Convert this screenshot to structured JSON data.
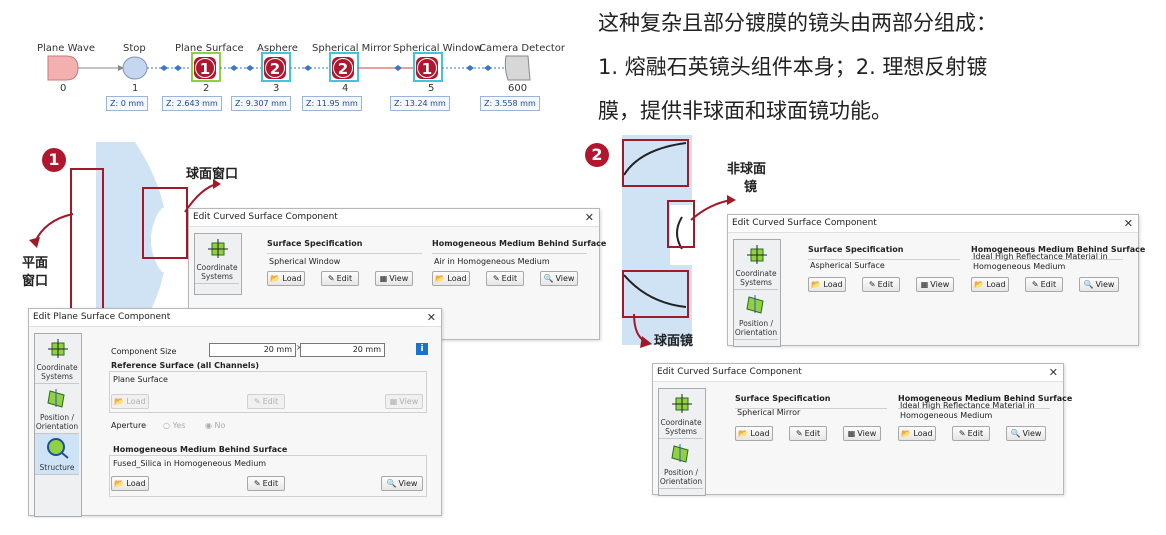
{
  "chain": {
    "elements": [
      {
        "label": "Plane Wave",
        "index": "0"
      },
      {
        "label": "Stop",
        "index": "1"
      },
      {
        "label": "Plane Surface",
        "index": "2"
      },
      {
        "label": "Asphere",
        "index": "3"
      },
      {
        "label": "Spherical Mirror",
        "index": "4"
      },
      {
        "label": "Spherical Window",
        "index": "5"
      },
      {
        "label": "Camera Detector",
        "index": "600"
      }
    ],
    "z_positions": [
      "Z: 0 mm",
      "Z: 2.643 mm",
      "Z: 9.307 mm",
      "Z: 11.95 mm",
      "Z: 13.24 mm",
      "Z: 3.558 mm"
    ],
    "badges": [
      "1",
      "2",
      "2",
      "1"
    ]
  },
  "description": {
    "line1": "这种复杂且部分镀膜的镜头由两部分组成：",
    "line2": "1. 熔融石英镜头组件本身；2. 理想反射镀",
    "line3": "膜，提供非球面和球面镜功能。"
  },
  "callouts": {
    "badge1": "1",
    "badge2": "2",
    "spherical_window": "球面窗口",
    "plane_window_1": "平面",
    "plane_window_2": "窗口",
    "aspheric_1": "非球面",
    "aspheric_2": "镜",
    "spherical_mirror": "球面镜"
  },
  "dialog_window": {
    "title": "Edit Curved Surface Component",
    "side": [
      "Coordinate Systems"
    ],
    "surface_spec_title": "Surface Specification",
    "surface_spec_value": "Spherical Window",
    "medium_title": "Homogeneous Medium Behind Surface",
    "medium_value": "Air in Homogeneous Medium",
    "load": "Load",
    "edit": "Edit",
    "view": "View"
  },
  "dialog_plane": {
    "title": "Edit Plane Surface Component",
    "side": [
      "Coordinate Systems",
      "Position / Orientation",
      "Structure"
    ],
    "component_size_label": "Component Size",
    "size_x": "20 mm",
    "size_sep": "×",
    "size_y": "20 mm",
    "info": "i",
    "reference_title": "Reference Surface (all Channels)",
    "reference_value": "Plane Surface",
    "aperture_label": "Aperture",
    "aperture_yes": "Yes",
    "aperture_no": "No",
    "medium_title": "Homogeneous Medium Behind Surface",
    "medium_value": "Fused_Silica in Homogeneous Medium",
    "load": "Load",
    "edit": "Edit",
    "view": "View"
  },
  "dialog_asphere": {
    "title": "Edit Curved Surface Component",
    "side": [
      "Coordinate Systems",
      "Position / Orientation"
    ],
    "surface_spec_title": "Surface Specification",
    "surface_spec_value": "Aspherical Surface",
    "medium_title": "Homogeneous Medium Behind Surface",
    "medium_value_1": "Ideal High Reflectance Material in",
    "medium_value_2": "Homogeneous Medium",
    "load": "Load",
    "edit": "Edit",
    "view": "View"
  },
  "dialog_mirror": {
    "title": "Edit Curved Surface Component",
    "side": [
      "Coordinate Systems",
      "Position / Orientation"
    ],
    "surface_spec_title": "Surface Specification",
    "surface_spec_value": "Spherical Mirror",
    "medium_title": "Homogeneous Medium Behind Surface",
    "medium_value_1": "Ideal High Reflectance Material in",
    "medium_value_2": "Homogeneous Medium",
    "load": "Load",
    "edit": "Edit",
    "view": "View"
  },
  "colors": {
    "accent_red": "#b0172f",
    "lens_blue": "#cfe3f5",
    "source_pink": "#f3b0b0",
    "highlight_green": "#8fd13f",
    "highlight_cyan": "#3fc6dc"
  }
}
